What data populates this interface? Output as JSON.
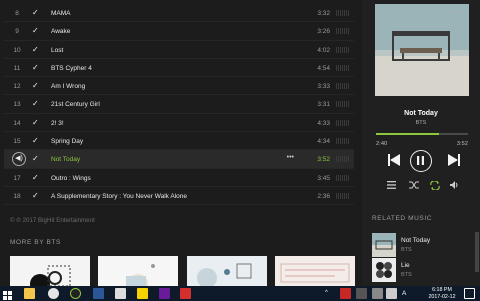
{
  "tracks": [
    {
      "num": "8",
      "title": "MAMA",
      "time": "3:32"
    },
    {
      "num": "9",
      "title": "Awake",
      "time": "3:26"
    },
    {
      "num": "10",
      "title": "Lost",
      "time": "4:02"
    },
    {
      "num": "11",
      "title": "BTS Cypher 4",
      "time": "4:54"
    },
    {
      "num": "12",
      "title": "Am I Wrong",
      "time": "3:33"
    },
    {
      "num": "13",
      "title": "21st Century Girl",
      "time": "3:31"
    },
    {
      "num": "14",
      "title": "2! 3!",
      "time": "4:33"
    },
    {
      "num": "15",
      "title": "Spring Day",
      "time": "4:34"
    },
    {
      "num": "",
      "title": "Not Today",
      "time": "3:52",
      "more": "•••"
    },
    {
      "num": "17",
      "title": "Outro : Wings",
      "time": "3:45"
    },
    {
      "num": "18",
      "title": "A Supplementary Story : You Never Walk Alone",
      "time": "2:36"
    }
  ],
  "copyright": "© ℗ 2017 BigHit Entertainment",
  "more_by": "MORE BY BTS",
  "now_playing": {
    "title": "Not Today",
    "artist": "BTS",
    "elapsed": "2:40",
    "total": "3:52",
    "progress": 0.69
  },
  "related_heading": "RELATED MUSIC",
  "related": [
    {
      "title": "Not Today",
      "artist": "BTS"
    },
    {
      "title": "Lie",
      "artist": "BTS"
    }
  ],
  "taskbar": {
    "time": "6:18 PM",
    "date": "2017-02-12",
    "lang": "A"
  },
  "colors": {
    "accent": "#8dc63f",
    "background": "#1c1c1c"
  },
  "icons": [
    "check-icon",
    "speaker-icon",
    "more-icon",
    "prev-icon",
    "pause-icon",
    "next-icon",
    "queue-icon",
    "shuffle-icon",
    "repeat-icon",
    "volume-icon"
  ]
}
